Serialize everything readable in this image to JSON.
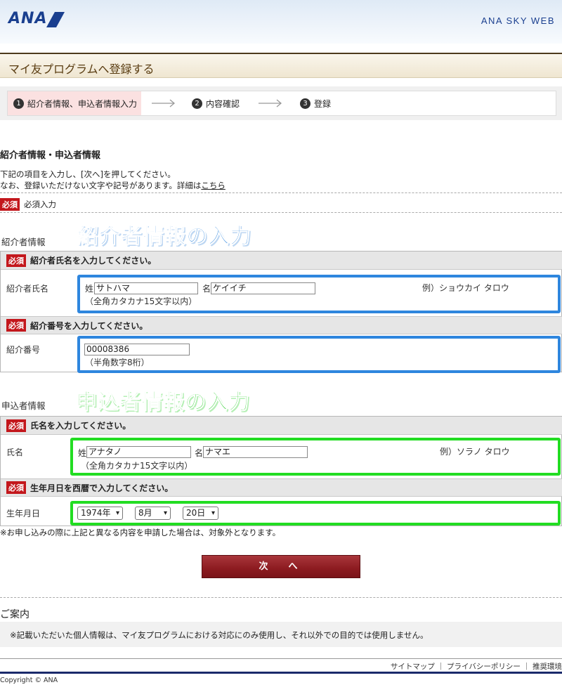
{
  "header": {
    "logo_text": "ANA",
    "site_name": "ANA SKY WEB",
    "brand_color": "#1a3f8f"
  },
  "page_title": "マイ友プログラムへ登録する",
  "steps": [
    {
      "num": "1",
      "label": "紹介者情報、申込者情報入力",
      "active": true
    },
    {
      "num": "2",
      "label": "内容確認",
      "active": false
    },
    {
      "num": "3",
      "label": "登録",
      "active": false
    }
  ],
  "section": {
    "title": "紹介者情報・申込者情報",
    "intro_line1": "下記の項目を入力し、[次へ]を押してください。",
    "intro_line2": "なお、登録いただけない文字や記号があります。詳細は",
    "intro_link": "こちら",
    "required_badge": "必須",
    "required_legend": "必須入力"
  },
  "referrer": {
    "group_label": "紹介者情報",
    "annotation": "紹介者情報の入力",
    "annotation_color": "#2e86de",
    "name_prompt": "紹介者氏名を入力してください。",
    "name_label": "紹介者氏名",
    "sei_label": "姓",
    "sei_value": "サトハマ",
    "mei_label": "名",
    "mei_value": "ケイイチ",
    "name_example": "例）ショウカイ タロウ",
    "name_note": "（全角カタカナ15文字以内）",
    "number_prompt": "紹介番号を入力してください。",
    "number_label": "紹介番号",
    "number_value": "00008386",
    "number_note": "（半角数字8桁）"
  },
  "applicant": {
    "group_label": "申込者情報",
    "annotation": "申込者情報の入力",
    "annotation_color": "#22dd22",
    "name_prompt": "氏名を入力してください。",
    "name_label": "氏名",
    "sei_label": "姓",
    "sei_value": "アナタノ",
    "mei_label": "名",
    "mei_value": "ナマエ",
    "name_example": "例）ソラノ タロウ",
    "name_note": "（全角カタカナ15文字以内）",
    "birth_prompt": "生年月日を西暦で入力してください。",
    "birth_label": "生年月日",
    "year": "1974年",
    "month": "8月",
    "day": "20日"
  },
  "notice": "※お申し込みの際に上記と異なる内容を申請した場合は、対象外となります。",
  "next_button": "次　へ",
  "guide": {
    "heading": "ご案内",
    "text": "※記載いただいた個人情報は、マイ友プログラムにおける対応にのみ使用し、それ以外での目的では使用しません。"
  },
  "footer": {
    "links": "サイトマップ ｜ プライバシーポリシー ｜ 推奨環境",
    "copyright": "Copyright © ANA"
  }
}
